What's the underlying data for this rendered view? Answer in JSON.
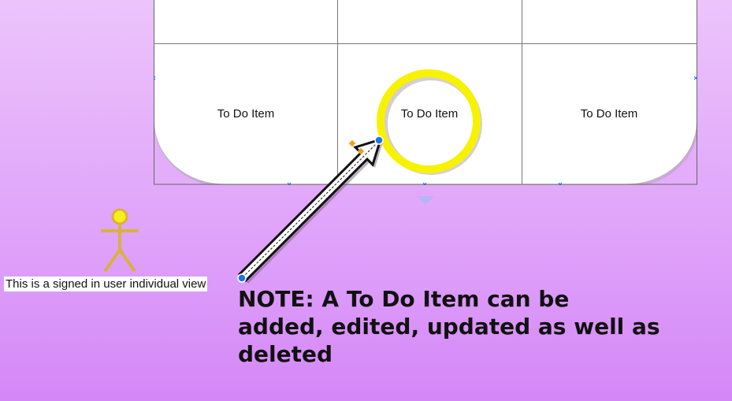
{
  "table": {
    "cells": [
      {
        "label": "To Do Item"
      },
      {
        "label": "To Do Item"
      },
      {
        "label": "To Do Item"
      }
    ]
  },
  "actor": {
    "caption": "This is a signed in user individual view",
    "icon": "stick-figure-icon"
  },
  "highlight": {
    "icon": "highlight-circle-icon"
  },
  "arrow": {
    "icon": "arrow-icon"
  },
  "note": {
    "lines": [
      "NOTE: A To Do Item can be",
      "added, edited, updated as well as",
      "deleted"
    ]
  },
  "colors": {
    "background_top": "#ecc4fb",
    "background_bottom": "#d487f7",
    "highlight_ring": "#f7f200",
    "actor": "#d9b13b",
    "handle": "#1f6fd6",
    "table_fill": "#ffffff",
    "table_line": "#555555"
  }
}
